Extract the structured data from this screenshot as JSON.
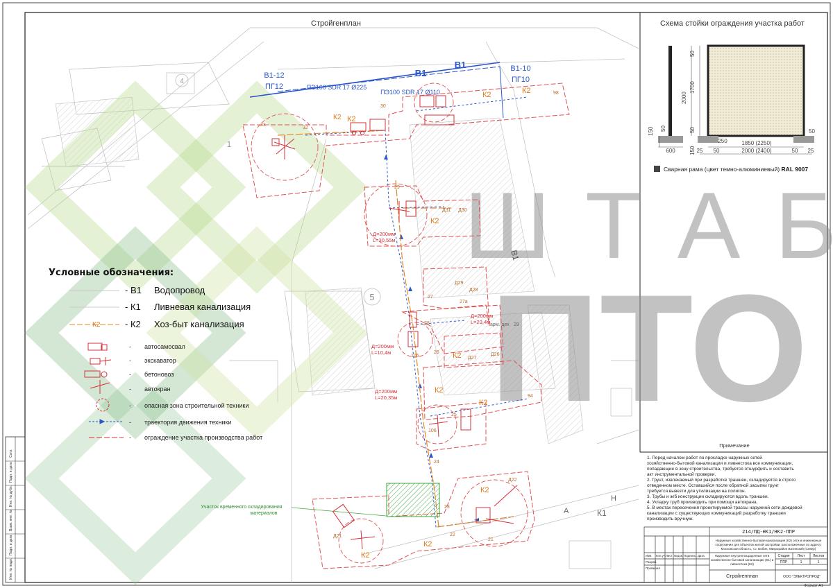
{
  "titles": {
    "plan": "Стройгенплан",
    "fence_scheme": "Схема стойки ограждения участка работ"
  },
  "fence": {
    "dims": {
      "h2000": "2000",
      "h1700": "1700",
      "h50a": "50",
      "h50b": "50",
      "h150a": "150",
      "h150b": "150",
      "d50": "50",
      "w1850": "1850 (2250)",
      "w2000": "2000 (2400)",
      "w250": "250",
      "w600": "600",
      "s25a": "25",
      "s50a": "50",
      "s50b": "50",
      "s25b": "25",
      "m50": "50"
    },
    "caption_prefix": "Сварная рама (цвет темно-алюминиевый)",
    "caption_ral": "RAL 9007"
  },
  "watermark": {
    "line1": "Ш Т А Б",
    "line2": "ПТО"
  },
  "legend": {
    "title": "Условные обозначения:",
    "k2_sample": "К2",
    "rows": [
      {
        "code": "- В1",
        "text": "Водопровод"
      },
      {
        "code": "- К1",
        "text": "Ливневая канализация"
      },
      {
        "code": "- К2",
        "text": "Хоз-быт канализация"
      }
    ],
    "equipment": [
      {
        "dash": "-",
        "text": "автосамосвал"
      },
      {
        "dash": "-",
        "text": "экскаватор"
      },
      {
        "dash": "-",
        "text": "бетоновоз"
      },
      {
        "dash": "-",
        "text": "автокран"
      },
      {
        "dash": "-",
        "text": "опасная зона строительной техники"
      },
      {
        "dash": "-",
        "text": "траектория движения техники"
      },
      {
        "dash": "-",
        "text": "ограждение участка производства работ"
      }
    ]
  },
  "map": {
    "v1_left_label": "В1-12",
    "pg_left": "ПГ12",
    "v1_right_label": "В1-10",
    "pg_right": "ПГ10",
    "v1_a": "В1",
    "v1_b": "В1",
    "v1_diag": "В1",
    "pipe_225": "ПЭ100 SDR 17 Ø225",
    "pipe_110": "ПЭ100 SDR 17 Ø110",
    "num_4": "4",
    "num_1": "1",
    "num_5": "5",
    "k2_labels": [
      "К2",
      "К2",
      "К2",
      "К2",
      "К2",
      "К2",
      "К2",
      "К2",
      "К2",
      "К2",
      "К2"
    ],
    "wells": [
      "98",
      "30",
      "33",
      "32",
      "29",
      "Д30",
      "Д31",
      "Д29",
      "Д28",
      "27а",
      "27",
      "28",
      "Д27",
      "26",
      "Д26",
      "105",
      "25",
      "106",
      "24",
      "23",
      "22",
      "21",
      "Д21",
      "Д22",
      "94"
    ],
    "pipe_d1": "Д=200мм",
    "pipe_l1": "L=30,55м",
    "pipe_d2": "Д=200мм",
    "pipe_l2": "L=23,4м",
    "pipe_d3": "Д=200мм",
    "pipe_l3": "L=10,4м",
    "pipe_d4": "Д=200мм",
    "pipe_l4": "L=20,35м",
    "arm_tseh": "арм. цех",
    "arm_num": "29",
    "storage_line1": "Участок временного складирования",
    "storage_line2": "материалов",
    "k1_label": "К1",
    "a_label": "А",
    "n_label": "Н"
  },
  "notes": {
    "title": "Примечание",
    "items": [
      "1.  Перед началом работ по прокладке наружных сетей",
      "     хозяйственно-бытовой канализации и ливнестока все коммуникации,",
      "     попадающие в зону строительства, требуется отшурфить и составить",
      "     акт инструментальной проверки.",
      "2.  Грунт, извлекаемый при разработке траншеи, складируется в строго",
      "     отведенном месте. Оставшийся после обратной засыпки грунт",
      "     требуется вывезти для утилизации на полигон.",
      "3.  Трубы и ж/б конструкции складируются вдоль траншеи.",
      "4.  Укладку труб производить при помощи автокрана.",
      "5.  В местах пересечения проектируемой трассы наружной сети дождевой",
      "     канализации с существующих коммуникаций разработку траншеи",
      "     производить вручную."
    ]
  },
  "stamp": {
    "code": "214/ПД-НК1/НК2-ППР",
    "project_lines": [
      "Наружные хозяйственно-бытовая канализация (К2) сети и инженерные",
      "сооружения для объектов жилой застройки, расположенные по адресу:",
      "Московская область, г.о. Бобин, Микрорайон Ватинский (Север)"
    ],
    "sheet_title_lines": [
      "Наружные внутриплощадочные сети",
      "хозяйственно-бытовой канализации (К1) и",
      "ливнестока (К2)"
    ],
    "col_heads": [
      "Изм.",
      "Кол.уч.",
      "Лист",
      "№док.",
      "Подпись",
      "Дата"
    ],
    "developed": "Разраб.",
    "checked": "Проверил",
    "stage_head": "Стадия",
    "sheet_head": "Лист",
    "sheets_head": "Листов",
    "stage_val": "ППР",
    "sheet_val": "1",
    "sheets_val": "1",
    "drawing_name": "Стройгенплан",
    "company": "ООО \"ЭЛЕКТРОПРОД\"",
    "format": "Формат А1"
  },
  "side_stamp": [
    "Взам. инв. №",
    "Подп. и дата",
    "Инв. № подл.",
    "Инв. № дубл.",
    "Подп. и дата",
    "Согл."
  ]
}
